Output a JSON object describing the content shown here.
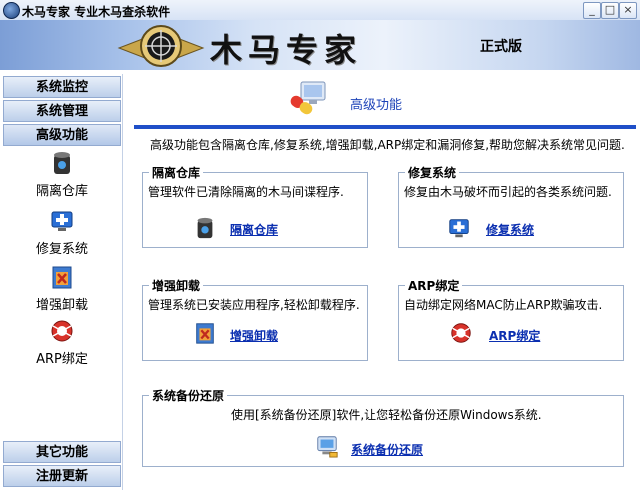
{
  "window": {
    "title": "木马专家  专业木马查杀软件",
    "buttons": {
      "minimize": "_",
      "maximize": "□",
      "close": "×"
    }
  },
  "banner": {
    "brand": "木马专家",
    "edition": "正式版"
  },
  "sidebar": {
    "nav_top": [
      "系统监控",
      "系统管理",
      "高级功能"
    ],
    "items": [
      {
        "label": "隔离仓库",
        "icon": "quarantine-bin-icon"
      },
      {
        "label": "修复系统",
        "icon": "repair-system-icon"
      },
      {
        "label": "增强卸载",
        "icon": "uninstall-icon"
      },
      {
        "label": "ARP绑定",
        "icon": "arp-bind-icon"
      }
    ],
    "nav_bottom": [
      "其它功能",
      "注册更新"
    ]
  },
  "main": {
    "title": "高级功能",
    "title_icon": "pill-monitor-icon",
    "intro": "高级功能包含隔离仓库,修复系统,增强卸载,ARP绑定和漏洞修复,帮助您解决系统常见问题.",
    "groups": {
      "quarantine": {
        "title": "隔离仓库",
        "desc": "管理软件已清除隔离的木马间谍程序.",
        "link": "隔离仓库"
      },
      "repair": {
        "title": "修复系统",
        "desc": "修复由木马破坏而引起的各类系统问题.",
        "link": "修复系统"
      },
      "uninstall": {
        "title": "增强卸载",
        "desc": "管理系统已安装应用程序,轻松卸载程序.",
        "link": "增强卸载"
      },
      "arp": {
        "title": "ARP绑定",
        "desc": "自动绑定网络MAC防止ARP欺骗攻击.",
        "link": "ARP绑定"
      },
      "backup": {
        "title": "系统备份还原",
        "desc": "使用[系统备份还原]软件,让您轻松备份还原Windows系统.",
        "link": "系统备份还原"
      }
    }
  },
  "colors": {
    "accent_blue": "#1f4fc8",
    "link_blue": "#0b2fb0",
    "nav_bg": "#bccfea"
  }
}
